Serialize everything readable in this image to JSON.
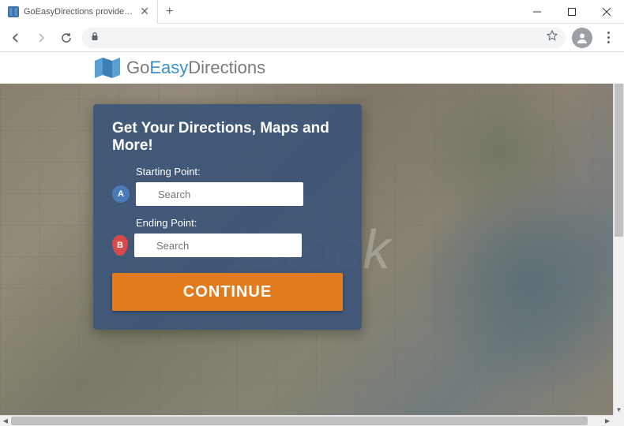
{
  "window": {
    "tab_title": "GoEasyDirections provides you w",
    "new_tab": "+",
    "minimize": "—",
    "maximize": "☐",
    "close": "✕"
  },
  "toolbar": {
    "back_icon": "←",
    "forward_icon": "→",
    "reload_icon": "↻",
    "lock_icon": "🔒",
    "star_icon": "☆",
    "menu_icon": "⋮"
  },
  "logo": {
    "part1": "Go",
    "part2": "Easy",
    "part3": "Directions"
  },
  "form": {
    "heading": "Get Your Directions, Maps and More!",
    "start_label": "Starting Point:",
    "start_placeholder": "Search",
    "marker_a": "A",
    "end_label": "Ending Point:",
    "end_placeholder": "Search",
    "marker_b": "B",
    "continue_label": "CONTINUE"
  },
  "watermark": "iStock",
  "colors": {
    "accent": "#e07b1e",
    "panel": "rgba(60,85,120,0.92)",
    "marker_a": "#4a7ab8",
    "marker_b": "#d84a4a",
    "logo_blue": "#3b8fc7"
  }
}
